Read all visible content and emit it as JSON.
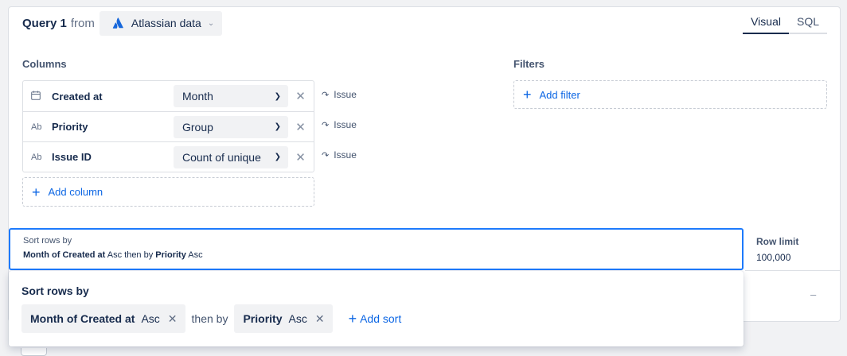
{
  "query": {
    "title": "Query 1",
    "from_label": "from",
    "source_name": "Atlassian data",
    "source_icon": "atlassian-logo"
  },
  "tabs": [
    {
      "label": "Visual",
      "active": true
    },
    {
      "label": "SQL",
      "active": false
    }
  ],
  "columns": {
    "heading": "Columns",
    "rows": [
      {
        "type_icon": "calendar-icon",
        "name": "Created at",
        "aggregation": "Month",
        "source": "Issue"
      },
      {
        "type_icon": "Ab",
        "name": "Priority",
        "aggregation": "Group",
        "source": "Issue"
      },
      {
        "type_icon": "Ab",
        "name": "Issue ID",
        "aggregation": "Count of unique",
        "source": "Issue"
      }
    ],
    "add_label": "Add column"
  },
  "filters": {
    "heading": "Filters",
    "add_label": "Add filter"
  },
  "sort_bar": {
    "label": "Sort rows by",
    "first_field": "Month of Created at",
    "first_dir": "Asc",
    "then_by": "then by",
    "second_field": "Priority",
    "second_dir": "Asc"
  },
  "row_limit": {
    "label": "Row limit",
    "value": "100,000"
  },
  "sort_popup": {
    "title": "Sort rows by",
    "chips": [
      {
        "field": "Month of Created at",
        "dir": "Asc"
      },
      {
        "field": "Priority",
        "dir": "Asc"
      }
    ],
    "then_by": "then by",
    "add_label": "Add sort"
  },
  "collapse_glyph": "–",
  "colors": {
    "accent": "#0c66e4",
    "focus_border": "#1d7afc",
    "atlassian_blue": "#1868db"
  }
}
